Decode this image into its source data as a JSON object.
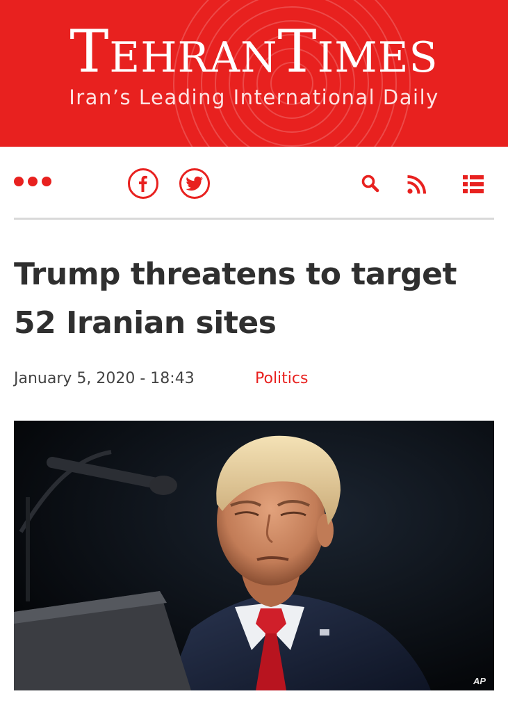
{
  "masthead": {
    "title_first_initial": "T",
    "title_first_rest": "EHRAN",
    "title_second_initial": "T",
    "title_second_rest": "IMES",
    "tagline": "Iran’s Leading International Daily",
    "color": "#e8211f"
  },
  "nav": {
    "icons": [
      "more-dots-icon",
      "facebook-icon",
      "twitter-icon",
      "search-icon",
      "rss-icon",
      "menu-list-icon"
    ],
    "accent_color": "#e8211f"
  },
  "article": {
    "headline": "Trump threatens to target 52 Iranian sites",
    "date": "January 5, 2020 - 18:43",
    "category": "Politics",
    "photo_credit": "AP"
  }
}
